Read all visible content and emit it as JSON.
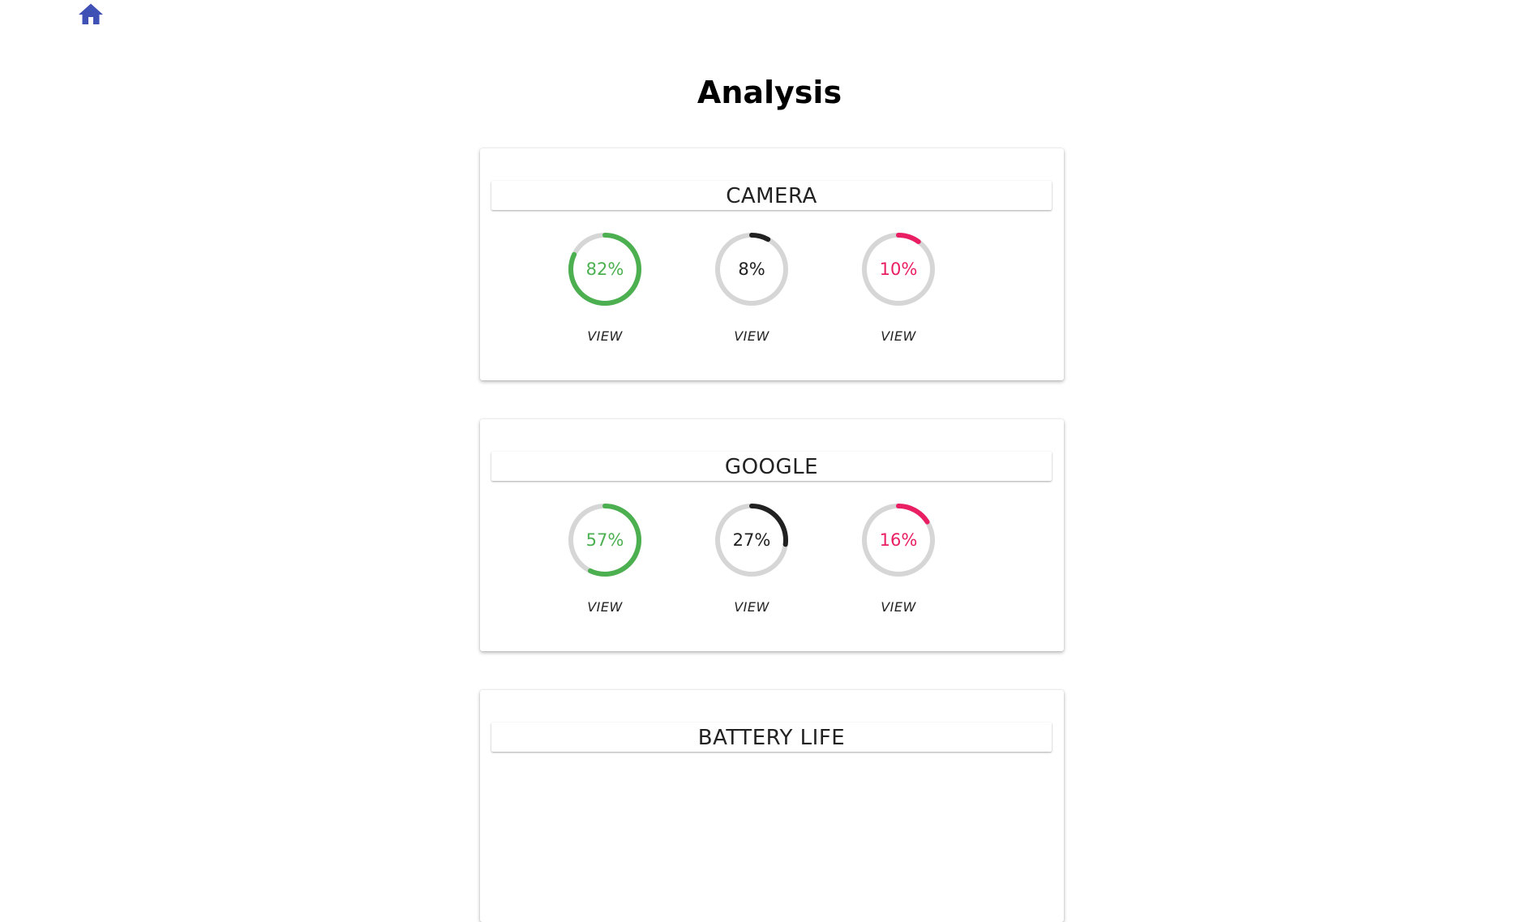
{
  "page_title": "Analysis",
  "colors": {
    "home_icon": "#3f51b5",
    "track": "#d6d6d6",
    "green": "#4caf50",
    "black": "#212121",
    "pink": "#e91e63"
  },
  "cards": [
    {
      "title": "CAMERA",
      "gauges": [
        {
          "value": 82,
          "label": "82%",
          "color": "green",
          "action": "VIEW"
        },
        {
          "value": 8,
          "label": "8%",
          "color": "black",
          "action": "VIEW"
        },
        {
          "value": 10,
          "label": "10%",
          "color": "pink",
          "action": "VIEW"
        }
      ]
    },
    {
      "title": "GOOGLE",
      "gauges": [
        {
          "value": 57,
          "label": "57%",
          "color": "green",
          "action": "VIEW"
        },
        {
          "value": 27,
          "label": "27%",
          "color": "black",
          "action": "VIEW"
        },
        {
          "value": 16,
          "label": "16%",
          "color": "pink",
          "action": "VIEW"
        }
      ]
    },
    {
      "title": "BATTERY LIFE",
      "gauges": []
    }
  ]
}
